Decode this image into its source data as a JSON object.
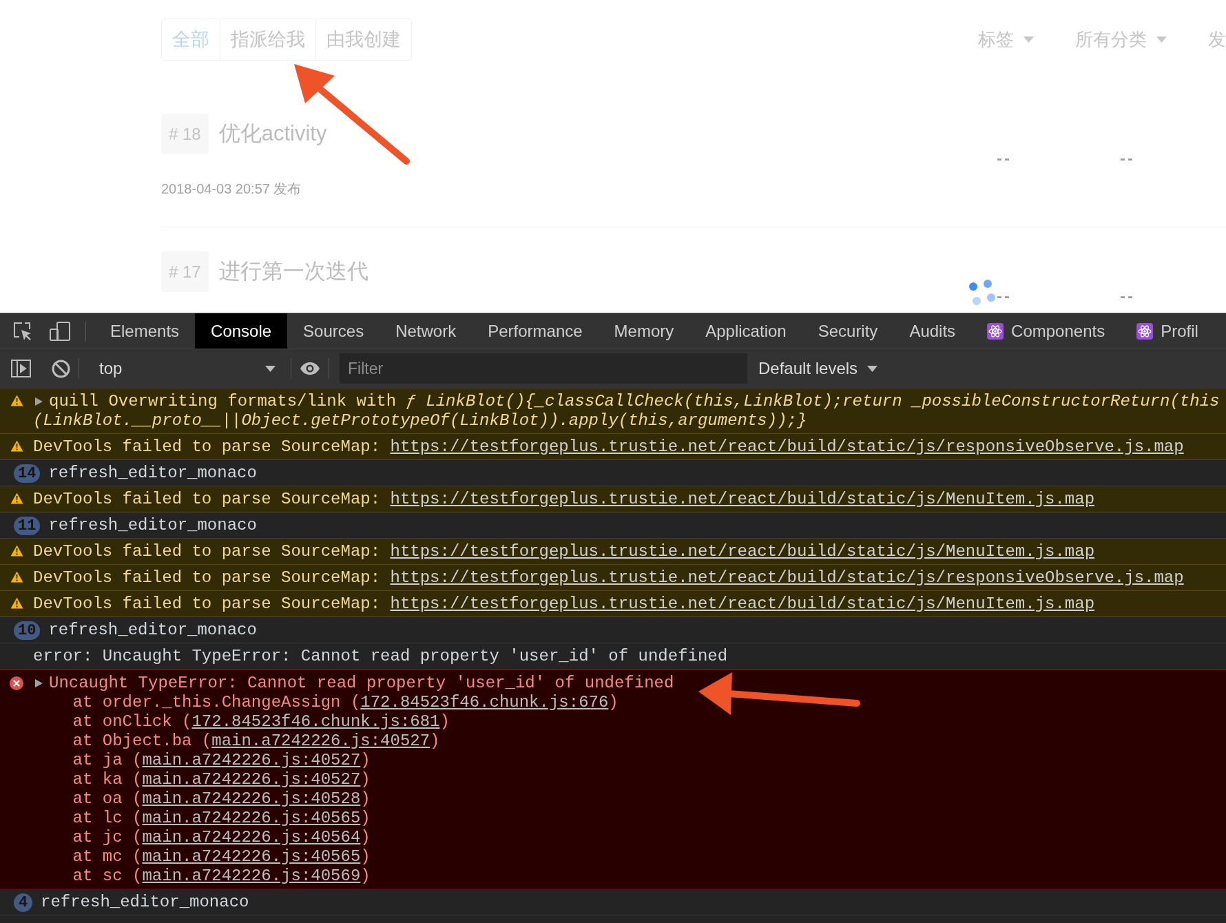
{
  "page": {
    "filter_tabs": [
      {
        "label": "全部",
        "selected": true
      },
      {
        "label": "指派给我",
        "selected": false
      },
      {
        "label": "由我创建",
        "selected": false
      }
    ],
    "filters": [
      {
        "label": "标签",
        "kind": "dropdown"
      },
      {
        "label": "所有分类",
        "kind": "dropdown"
      },
      {
        "label": "发",
        "kind": "label"
      }
    ],
    "issues": [
      {
        "number": "# 18",
        "title": "优化activity",
        "published": "2018-04-03 20:57 发布",
        "columns": [
          "--",
          "--"
        ]
      },
      {
        "number": "# 17",
        "title": "进行第一次迭代",
        "columns": [
          "--",
          "--"
        ]
      }
    ],
    "loading": true
  },
  "devtools": {
    "tabs": [
      {
        "label": "Elements",
        "kind": "panel",
        "selected": false
      },
      {
        "label": "Console",
        "kind": "panel",
        "selected": true
      },
      {
        "label": "Sources",
        "kind": "panel",
        "selected": false
      },
      {
        "label": "Network",
        "kind": "panel",
        "selected": false
      },
      {
        "label": "Performance",
        "kind": "panel",
        "selected": false
      },
      {
        "label": "Memory",
        "kind": "panel",
        "selected": false
      },
      {
        "label": "Application",
        "kind": "panel",
        "selected": false
      },
      {
        "label": "Security",
        "kind": "panel",
        "selected": false
      },
      {
        "label": "Audits",
        "kind": "panel",
        "selected": false
      },
      {
        "label": "Components",
        "kind": "react",
        "selected": false
      },
      {
        "label": "Profil",
        "kind": "react",
        "selected": false
      }
    ],
    "toolbar": {
      "context": "top",
      "filter": {
        "placeholder": "Filter"
      },
      "levels": "Default levels"
    },
    "messages": [
      {
        "kind": "warning",
        "expanded": false,
        "text": "quill Overwriting formats/link with *ƒ LinkBlot(){_classCallCheck(this,LinkBlot);return _possibleConstructorReturn(this*",
        "continued": "(LinkBlot.__proto__||Object.getPrototypeOf(LinkBlot)).apply(this,arguments));}"
      },
      {
        "kind": "warning",
        "text": "DevTools failed to parse SourceMap:",
        "link": "https://testforgeplus.trustie.net/react/build/static/js/responsiveObserve.js.map"
      },
      {
        "kind": "log",
        "count": "14",
        "text": "refresh_editor_monaco"
      },
      {
        "kind": "warning",
        "text": "DevTools failed to parse SourceMap:",
        "link": "https://testforgeplus.trustie.net/react/build/static/js/MenuItem.js.map"
      },
      {
        "kind": "log",
        "count": "11",
        "text": "refresh_editor_monaco"
      },
      {
        "kind": "warning",
        "text": "DevTools failed to parse SourceMap:",
        "link": "https://testforgeplus.trustie.net/react/build/static/js/MenuItem.js.map"
      },
      {
        "kind": "warning",
        "text": "DevTools failed to parse SourceMap:",
        "link": "https://testforgeplus.trustie.net/react/build/static/js/responsiveObserve.js.map"
      },
      {
        "kind": "warning",
        "text": "DevTools failed to parse SourceMap:",
        "link": "https://testforgeplus.trustie.net/react/build/static/js/MenuItem.js.map"
      },
      {
        "kind": "log",
        "count": "10",
        "text": "refresh_editor_monaco"
      },
      {
        "kind": "log",
        "text": "error: Uncaught TypeError: Cannot read property 'user_id' of undefined"
      },
      {
        "kind": "error",
        "expanded": false,
        "text": "Uncaught TypeError: Cannot read property 'user_id' of undefined",
        "stack": [
          {
            "before": "at order._this.ChangeAssign (",
            "link": "172.84523f46.chunk.js:676",
            "after": ")"
          },
          {
            "before": "at onClick (",
            "link": "172.84523f46.chunk.js:681",
            "after": ")"
          },
          {
            "before": "at Object.ba (",
            "link": "main.a7242226.js:40527",
            "after": ")"
          },
          {
            "before": "at ja (",
            "link": "main.a7242226.js:40527",
            "after": ")"
          },
          {
            "before": "at ka (",
            "link": "main.a7242226.js:40527",
            "after": ")"
          },
          {
            "before": "at oa (",
            "link": "main.a7242226.js:40528",
            "after": ")"
          },
          {
            "before": "at lc (",
            "link": "main.a7242226.js:40565",
            "after": ")"
          },
          {
            "before": "at jc (",
            "link": "main.a7242226.js:40564",
            "after": ")"
          },
          {
            "before": "at mc (",
            "link": "main.a7242226.js:40565",
            "after": ")"
          },
          {
            "before": "at sc (",
            "link": "main.a7242226.js:40569",
            "after": ")"
          }
        ]
      },
      {
        "kind": "log",
        "count": "4",
        "text": "refresh_editor_monaco"
      }
    ]
  }
}
